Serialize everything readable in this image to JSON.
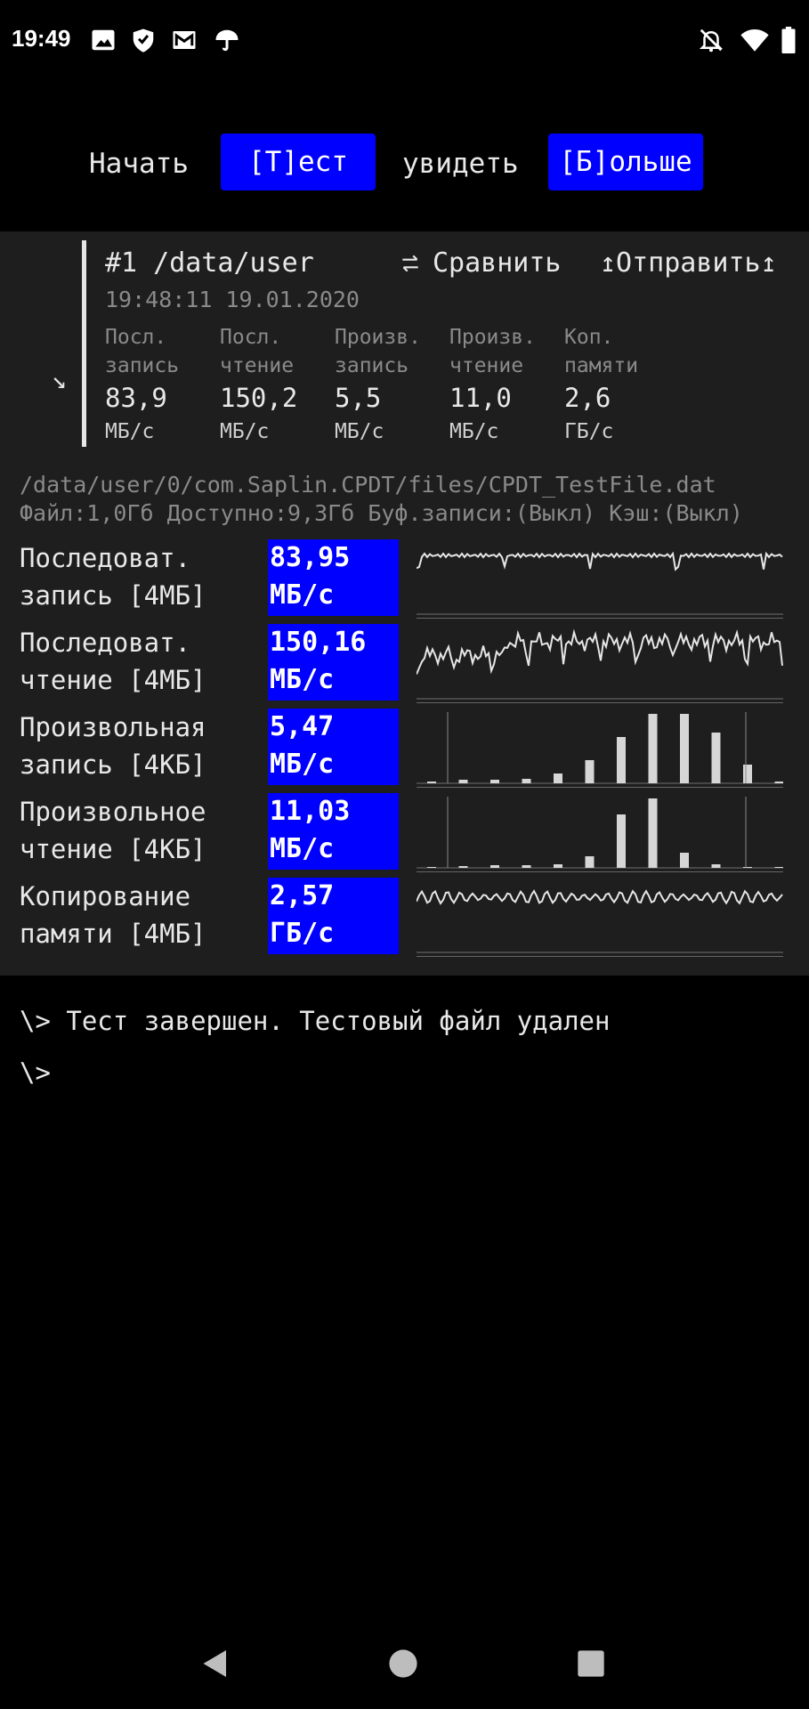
{
  "status_bar": {
    "time": "19:49"
  },
  "top_menu": {
    "start": "Начать",
    "test_button": "[Т]ест",
    "see": "увидеть",
    "more_button": "[Б]ольше"
  },
  "summary": {
    "title": "#1 /data/user",
    "compare": "Сравнить",
    "send": "↥Отправить↥",
    "timestamp": "19:48:11 19.01.2020",
    "arrow": "↘",
    "columns": [
      {
        "l1": "Посл.",
        "l2": "запись",
        "value": "83,9",
        "unit": "МБ/с"
      },
      {
        "l1": "Посл.",
        "l2": "чтение",
        "value": "150,2",
        "unit": "МБ/с"
      },
      {
        "l1": "Произв.",
        "l2": "запись",
        "value": "5,5",
        "unit": "МБ/с"
      },
      {
        "l1": "Произв.",
        "l2": "чтение",
        "value": "11,0",
        "unit": "МБ/с"
      },
      {
        "l1": "Коп.",
        "l2": "памяти",
        "value": "2,6",
        "unit": "ГБ/с"
      }
    ]
  },
  "file_info": {
    "path": "/data/user/0/com.Saplin.CPDT/files/CPDT_TestFile.dat",
    "details": "Файл:1,0Гб Доступно:9,3Гб Буф.записи:(Выкл) Кэш:(Выкл)"
  },
  "tests": [
    {
      "l1": "Последоват.",
      "l2": "запись [4МБ]",
      "value": "83,95",
      "unit": "МБ/с",
      "graph": "line"
    },
    {
      "l1": "Последоват.",
      "l2": "чтение [4МБ]",
      "value": "150,16",
      "unit": "МБ/с",
      "graph": "line"
    },
    {
      "l1": "Произвольная",
      "l2": "запись [4КБ]",
      "value": "5,47",
      "unit": "МБ/с",
      "graph": "bars"
    },
    {
      "l1": "Произвольное",
      "l2": "чтение [4КБ]",
      "value": "11,03",
      "unit": "МБ/с",
      "graph": "bars"
    },
    {
      "l1": "Копирование",
      "l2": "памяти [4МБ]",
      "value": "2,57",
      "unit": "ГБ/с",
      "graph": "line"
    }
  ],
  "console": {
    "prompt": "\\>",
    "message": "Тест завершен. Тестовый файл удален",
    "prompt2": "\\>"
  },
  "colors": {
    "accent": "#0000ff",
    "panel": "#1e1e1e"
  }
}
